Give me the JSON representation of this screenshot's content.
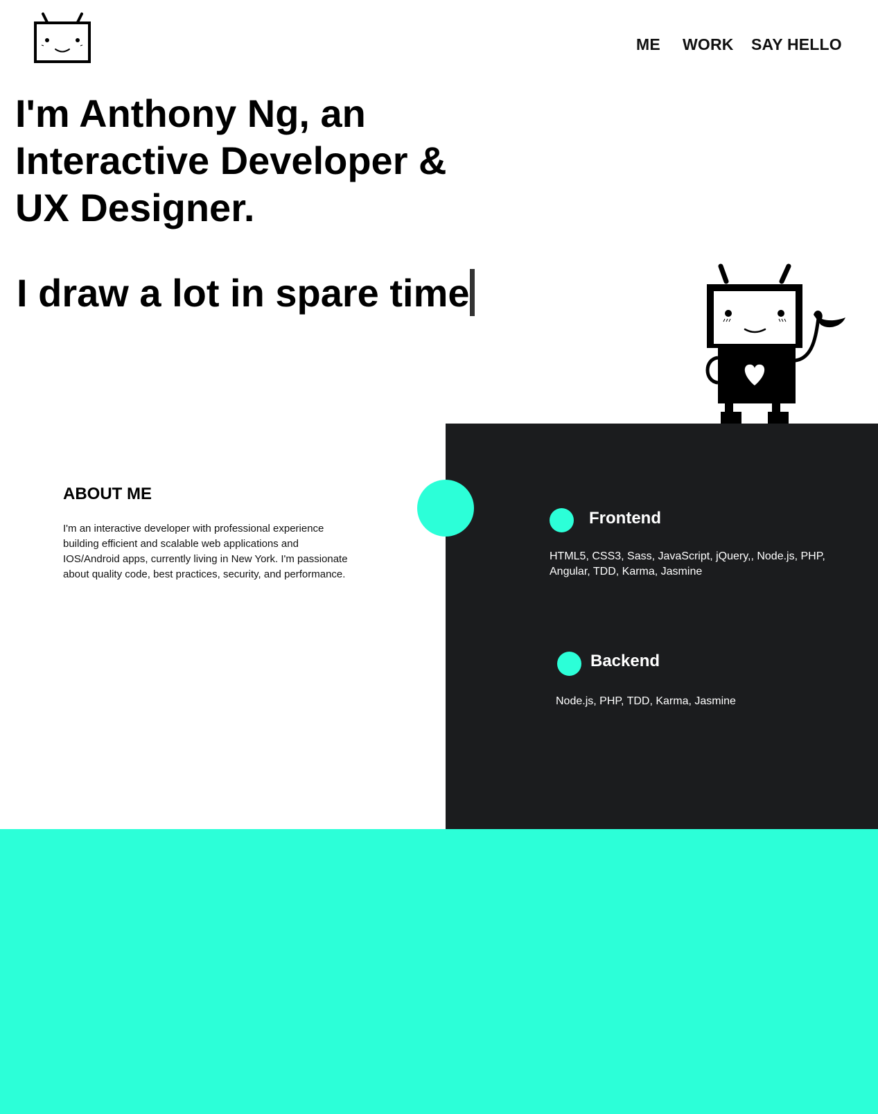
{
  "header": {
    "logo_icon": "robot-face-logo-icon",
    "nav": {
      "me": "ME",
      "work": "WORK",
      "say_hello": "SAY HELLO"
    }
  },
  "hero": {
    "headline": "I'm Anthony Ng, an Interactive Developer & UX Designer.",
    "typed_text": "I draw a lot in spare time",
    "mascot_icon": "waving-robot-icon"
  },
  "about": {
    "title": "ABOUT ME",
    "text": "I'm an interactive developer with professional experience building efficient and scalable web applications and IOS/Android apps, currently living in New York. I'm passionate about quality code, best practices, security, and performance."
  },
  "skills": [
    {
      "title": "Frontend",
      "text": "HTML5, CSS3, Sass, JavaScript, jQuery,, Node.js, PHP, Angular, TDD, Karma, Jasmine"
    },
    {
      "title": "Backend",
      "text": "Node.js, PHP, TDD, Karma, Jasmine"
    }
  ],
  "colors": {
    "accent": "#2cffd8",
    "dark_panel": "#1b1c1e",
    "background": "#ffffff"
  }
}
